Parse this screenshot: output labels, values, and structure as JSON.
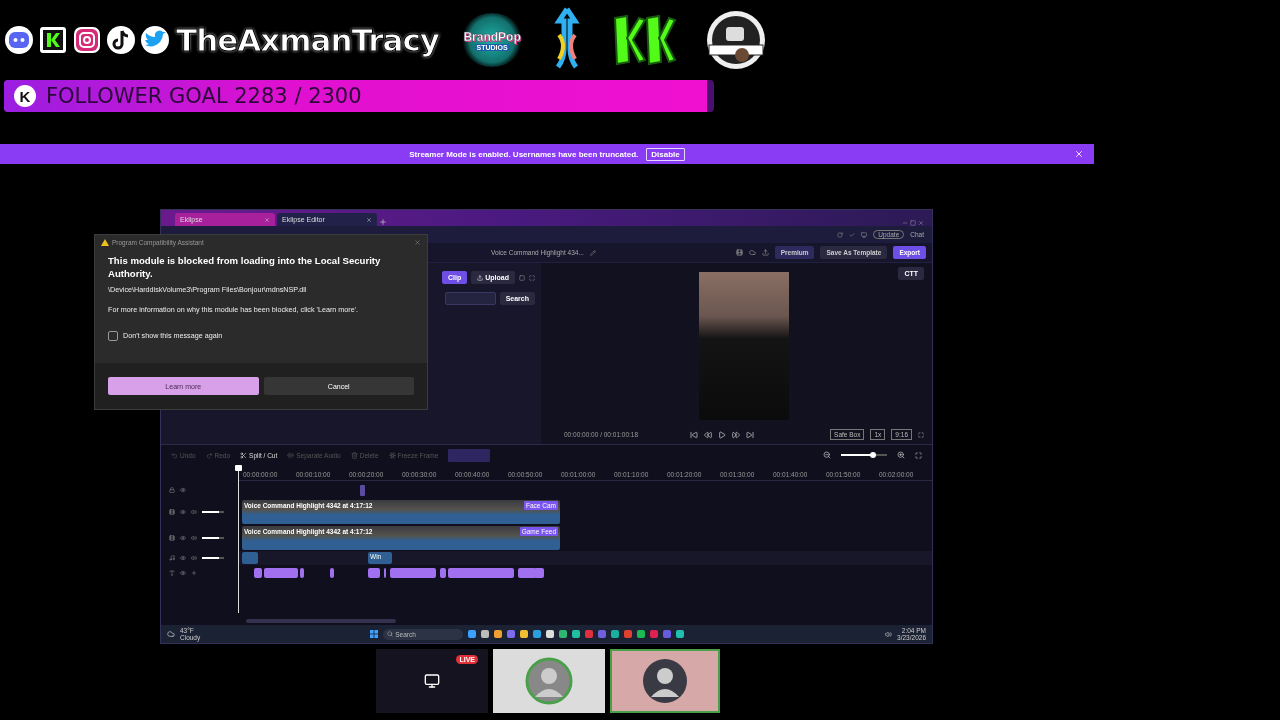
{
  "overlay": {
    "channel_name": "TheAxmanTracy",
    "sponsor": {
      "name": "BrandPop",
      "sub": "STUDIOS"
    },
    "goal": {
      "badge": "K",
      "label": "FOLLOWER GOAL 2283 / 2300",
      "level": 0.99
    }
  },
  "banner": {
    "message": "Streamer Mode is enabled. Usernames have been truncated.",
    "action": "Disable"
  },
  "browser": {
    "tabs": [
      {
        "label": "Eklipse",
        "selected": false
      },
      {
        "label": "Eklipse Editor",
        "selected": true
      }
    ],
    "update": "Update",
    "chat": "Chat"
  },
  "editor": {
    "title": "Voice Command Highlight 434...",
    "premium": "Premium",
    "save_template": "Save As Template",
    "export": "Export",
    "panel": {
      "clip": "Clip",
      "upload": "Upload",
      "search": "Search"
    },
    "ratio_tag": "CTT",
    "time": "00:00:00:00 / 00:01:00:18",
    "options": [
      "Safe Box",
      "1x",
      "9:16"
    ]
  },
  "timeline": {
    "tools": [
      {
        "label": "Undo",
        "disabled": true
      },
      {
        "label": "Redo",
        "disabled": true
      },
      {
        "label": "Split / Cut",
        "disabled": false
      },
      {
        "label": "Separate Audio",
        "disabled": true
      },
      {
        "label": "Delete",
        "disabled": true
      },
      {
        "label": "Freeze Frame",
        "disabled": true
      }
    ],
    "zoom": {
      "level": 0.7
    },
    "ruler": [
      "00:00:00:00",
      "00:00:10:00",
      "00:00:20:00",
      "00:00:30:00",
      "00:00:40:00",
      "00:00:50:00",
      "00:01:00:00",
      "00:01:10:00",
      "00:01:20:00",
      "00:01:30:00",
      "00:01:40:00",
      "00:01:50:00",
      "00:02:00:00"
    ],
    "tracks": [
      {
        "kind": "overlay"
      },
      {
        "kind": "video",
        "level": 0.75,
        "clip": "Voice Command Highlight 4342 at 4:17:12",
        "tag": "Face Cam"
      },
      {
        "kind": "video",
        "level": 0.75,
        "clip": "Voice Command Highlight 4342 at 4:17:12",
        "tag": "Game Feed"
      },
      {
        "kind": "audio",
        "level": 0.75,
        "clip": "Win"
      },
      {
        "kind": "text"
      }
    ]
  },
  "taskbar": {
    "weather": "43°F",
    "condition": "Cloudy",
    "search": "Search",
    "time": "2:04 PM",
    "date": "3/23/2026"
  },
  "dialog": {
    "title": "Program Compatibility Assistant",
    "heading": "This module is blocked from loading into the Local Security Authority.",
    "path": "\\Device\\HarddiskVolume3\\Program Files\\Bonjour\\mdnsNSP.dll",
    "info": "For more information on why this module has been blocked, click 'Learn more'.",
    "checkbox": {
      "label": "Don't show this message again",
      "checked": false
    },
    "buttons": [
      "Learn more",
      "Cancel"
    ]
  },
  "call": {
    "tiles": [
      {
        "kind": "screen",
        "badge": "LIVE",
        "speaking": false
      },
      {
        "kind": "avatar",
        "speaking": false
      },
      {
        "kind": "avatar",
        "speaking": true
      }
    ]
  }
}
